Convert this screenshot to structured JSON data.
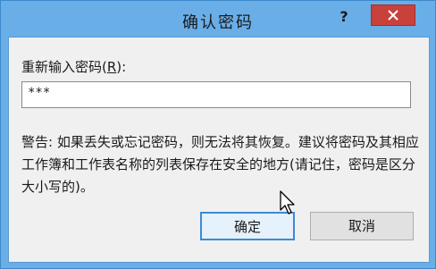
{
  "dialog": {
    "title": "确认密码",
    "help_label": "?",
    "close_icon": "close-icon"
  },
  "form": {
    "label_prefix": "重新输入密码(",
    "label_access_key": "R",
    "label_suffix": "):",
    "password_value": "***"
  },
  "warning": {
    "text": "警告: 如果丢失或忘记密码，则无法将其恢复。建议将密码及其相应工作簿和工作表名称的列表保存在安全的地方(请记住，密码是区分大小写的)。"
  },
  "buttons": {
    "ok_label": "确定",
    "cancel_label": "取消"
  },
  "colors": {
    "titlebar": "#6aaee8",
    "close": "#c8413b",
    "default_button_border": "#3c8ad6"
  }
}
